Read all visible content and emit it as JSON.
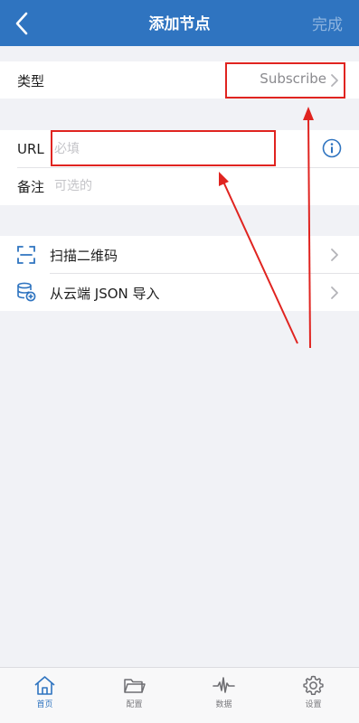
{
  "header": {
    "title": "添加节点",
    "done_label": "完成"
  },
  "type_row": {
    "label": "类型",
    "value": "Subscribe"
  },
  "url_row": {
    "label": "URL",
    "placeholder": "必填",
    "value": ""
  },
  "note_row": {
    "label": "备注",
    "placeholder": "可选的",
    "value": ""
  },
  "actions": [
    {
      "label": "扫描二维码",
      "icon": "qr-scan-icon"
    },
    {
      "label": "从云端 JSON 导入",
      "icon": "cloud-database-import-icon"
    }
  ],
  "tabs": [
    {
      "label": "首页",
      "icon": "home-icon",
      "active": true
    },
    {
      "label": "配置",
      "icon": "folder-icon",
      "active": false
    },
    {
      "label": "数据",
      "icon": "pulse-icon",
      "active": false
    },
    {
      "label": "设置",
      "icon": "gear-icon",
      "active": false
    }
  ],
  "colors": {
    "header_bg": "#2f74c0",
    "accent": "#2f74c0",
    "annotation_red": "#e02420",
    "background": "#f1f2f6"
  }
}
